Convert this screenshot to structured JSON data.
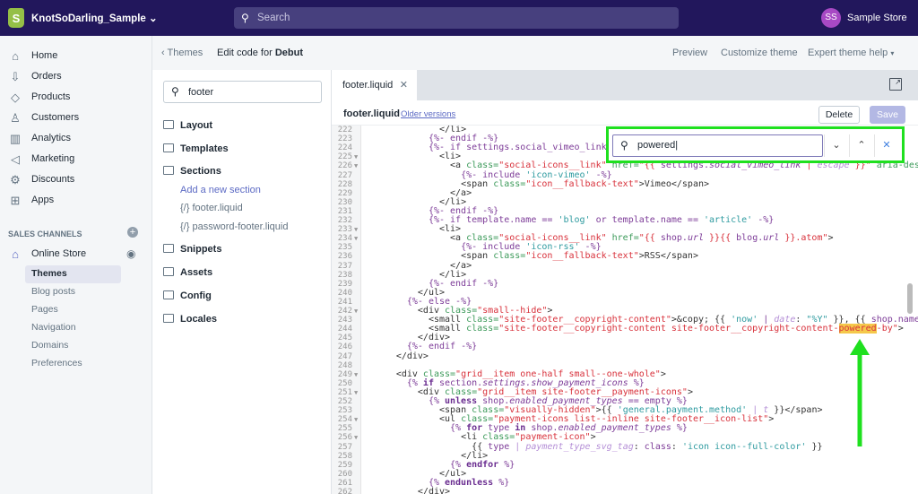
{
  "topbar": {
    "store_name": "KnotSoDarling_Sample",
    "search_placeholder": "Search",
    "avatar_initials": "SS",
    "account_name": "Sample Store",
    "bg": "#22175c"
  },
  "nav": {
    "items": [
      {
        "label": "Home",
        "icon": "home-icon",
        "glyph": "⌂"
      },
      {
        "label": "Orders",
        "icon": "orders-icon",
        "glyph": "⇩"
      },
      {
        "label": "Products",
        "icon": "tag-icon",
        "glyph": "◇"
      },
      {
        "label": "Customers",
        "icon": "person-icon",
        "glyph": "♙"
      },
      {
        "label": "Analytics",
        "icon": "bar-chart-icon",
        "glyph": "▥"
      },
      {
        "label": "Marketing",
        "icon": "megaphone-icon",
        "glyph": "◁"
      },
      {
        "label": "Discounts",
        "icon": "discount-icon",
        "glyph": "⚙"
      },
      {
        "label": "Apps",
        "icon": "apps-icon",
        "glyph": "⊞"
      }
    ],
    "section_label": "SALES CHANNELS",
    "online_store": "Online Store",
    "sub_items": [
      "Themes",
      "Blog posts",
      "Pages",
      "Navigation",
      "Domains",
      "Preferences"
    ]
  },
  "header": {
    "back": "Themes",
    "title_prefix": "Edit code for ",
    "theme": "Debut",
    "preview": "Preview",
    "customize": "Customize theme",
    "expert": "Expert theme help"
  },
  "files": {
    "search_value": "footer",
    "folders": [
      "Layout",
      "Templates",
      "Sections",
      "Snippets",
      "Assets",
      "Config",
      "Locales"
    ],
    "add_section": "Add a new section",
    "section_files": [
      "footer.liquid",
      "password-footer.liquid"
    ]
  },
  "editor": {
    "tab": "footer.liquid",
    "file": "footer.liquid",
    "older": "Older versions",
    "delete": "Delete",
    "save": "Save",
    "find": {
      "value": "powered",
      "next": "⌄",
      "prev": "⌃",
      "close": "✕"
    },
    "lines": [
      {
        "n": 222,
        "ind": 14,
        "t": [
          [
            "",
            "</li>"
          ]
        ]
      },
      {
        "n": 223,
        "ind": 12,
        "t": [
          [
            "k",
            "{%- endif -%}"
          ]
        ]
      },
      {
        "n": 224,
        "ind": 12,
        "t": [
          [
            "k",
            "{%- if settings.social_vimeo_link -%}"
          ]
        ]
      },
      {
        "n": 225,
        "ind": 14,
        "fold": true,
        "t": [
          [
            "",
            "<li>"
          ]
        ]
      },
      {
        "n": 226,
        "ind": 16,
        "fold": true,
        "t": [
          [
            "",
            "<a "
          ],
          [
            "a",
            "class="
          ],
          [
            "s",
            "\"social-icons__link\""
          ],
          [
            "a",
            " href="
          ],
          [
            "s",
            "\"{{ "
          ],
          [
            "k",
            "settings."
          ],
          [
            "i",
            "social_vimeo_link"
          ],
          [
            "s",
            " | "
          ],
          [
            "f",
            "escape"
          ],
          [
            "s",
            " }}\""
          ],
          [
            "a",
            " aria-describedby"
          ]
        ]
      },
      {
        "n": 227,
        "ind": 18,
        "t": [
          [
            "k",
            "{%- include "
          ],
          [
            "q",
            "'icon-vimeo'"
          ],
          [
            "k",
            " -%}"
          ]
        ]
      },
      {
        "n": 228,
        "ind": 18,
        "t": [
          [
            "",
            "<span "
          ],
          [
            "a",
            "class="
          ],
          [
            "s",
            "\"icon__fallback-text\""
          ],
          [
            "",
            ">Vimeo</span>"
          ]
        ]
      },
      {
        "n": 229,
        "ind": 16,
        "t": [
          [
            "",
            "</a>"
          ]
        ]
      },
      {
        "n": 230,
        "ind": 14,
        "t": [
          [
            "",
            "</li>"
          ]
        ]
      },
      {
        "n": 231,
        "ind": 12,
        "t": [
          [
            "k",
            "{%- endif -%}"
          ]
        ]
      },
      {
        "n": 232,
        "ind": 12,
        "t": [
          [
            "k",
            "{%- if template.name == "
          ],
          [
            "q",
            "'blog'"
          ],
          [
            "k",
            " or template.name == "
          ],
          [
            "q",
            "'article'"
          ],
          [
            "k",
            " -%}"
          ]
        ]
      },
      {
        "n": 233,
        "ind": 14,
        "fold": true,
        "t": [
          [
            "",
            "<li>"
          ]
        ]
      },
      {
        "n": 234,
        "ind": 16,
        "fold": true,
        "t": [
          [
            "",
            "<a "
          ],
          [
            "a",
            "class="
          ],
          [
            "s",
            "\"social-icons__link\""
          ],
          [
            "a",
            " href="
          ],
          [
            "s",
            "\"{{ "
          ],
          [
            "k",
            "shop."
          ],
          [
            "i",
            "url"
          ],
          [
            "s",
            " }}{{ "
          ],
          [
            "k",
            "blog."
          ],
          [
            "i",
            "url"
          ],
          [
            "s",
            " }}.atom\""
          ],
          [
            "",
            ">"
          ]
        ]
      },
      {
        "n": 235,
        "ind": 18,
        "t": [
          [
            "k",
            "{%- include "
          ],
          [
            "q",
            "'icon-rss'"
          ],
          [
            "k",
            " -%}"
          ]
        ]
      },
      {
        "n": 236,
        "ind": 18,
        "t": [
          [
            "",
            "<span "
          ],
          [
            "a",
            "class="
          ],
          [
            "s",
            "\"icon__fallback-text\""
          ],
          [
            "",
            ">RSS</span>"
          ]
        ]
      },
      {
        "n": 237,
        "ind": 16,
        "t": [
          [
            "",
            "</a>"
          ]
        ]
      },
      {
        "n": 238,
        "ind": 14,
        "t": [
          [
            "",
            "</li>"
          ]
        ]
      },
      {
        "n": 239,
        "ind": 12,
        "t": [
          [
            "k",
            "{%- endif -%}"
          ]
        ]
      },
      {
        "n": 240,
        "ind": 10,
        "t": [
          [
            "",
            "</ul>"
          ]
        ]
      },
      {
        "n": 241,
        "ind": 8,
        "t": [
          [
            "k",
            "{%- else -%}"
          ]
        ]
      },
      {
        "n": 242,
        "ind": 10,
        "fold": true,
        "t": [
          [
            "",
            "<div "
          ],
          [
            "a",
            "class="
          ],
          [
            "s",
            "\"small--hide\""
          ],
          [
            "",
            ">"
          ]
        ]
      },
      {
        "n": 243,
        "ind": 12,
        "t": [
          [
            "",
            "<small "
          ],
          [
            "a",
            "class="
          ],
          [
            "s",
            "\"site-footer__copyright-content\""
          ],
          [
            "",
            ">&copy; {{ "
          ],
          [
            "q",
            "'now'"
          ],
          [
            "k",
            " | "
          ],
          [
            "f",
            "date"
          ],
          [
            "",
            ": "
          ],
          [
            "q",
            "\"%Y\""
          ],
          [
            "",
            ""
          ],
          [
            "",
            " }}, {{ "
          ],
          [
            "k",
            "shop.name"
          ],
          [
            "",
            " }}"
          ]
        ]
      },
      {
        "n": 244,
        "ind": 12,
        "t": [
          [
            "",
            "<small "
          ],
          [
            "a",
            "class="
          ],
          [
            "s",
            "\"site-footer__copyright-content site-footer__copyright-content-"
          ],
          [
            "h",
            "powered"
          ],
          [
            "s",
            "-by\""
          ],
          [
            "",
            ">"
          ]
        ]
      },
      {
        "n": 245,
        "ind": 10,
        "t": [
          [
            "",
            "</div>"
          ]
        ]
      },
      {
        "n": 246,
        "ind": 8,
        "t": [
          [
            "k",
            "{%- endif -%}"
          ]
        ]
      },
      {
        "n": 247,
        "ind": 6,
        "t": [
          [
            "",
            "</div>"
          ]
        ]
      },
      {
        "n": 248,
        "ind": 0,
        "t": []
      },
      {
        "n": 249,
        "ind": 6,
        "fold": true,
        "t": [
          [
            "",
            "<div "
          ],
          [
            "a",
            "class="
          ],
          [
            "s",
            "\"grid__item one-half small--one-whole\""
          ],
          [
            "",
            ">"
          ]
        ]
      },
      {
        "n": 250,
        "ind": 8,
        "t": [
          [
            "k",
            "{% "
          ],
          [
            "b",
            "if"
          ],
          [
            "k",
            " section."
          ],
          [
            "i",
            "settings.show_payment_icons"
          ],
          [
            "k",
            " %}"
          ]
        ]
      },
      {
        "n": 251,
        "ind": 10,
        "fold": true,
        "t": [
          [
            "",
            "<div "
          ],
          [
            "a",
            "class="
          ],
          [
            "s",
            "\"grid__item site-footer__payment-icons\""
          ],
          [
            "",
            ">"
          ]
        ]
      },
      {
        "n": 252,
        "ind": 12,
        "t": [
          [
            "k",
            "{% "
          ],
          [
            "b",
            "unless"
          ],
          [
            "k",
            " shop."
          ],
          [
            "i",
            "enabled_payment_types"
          ],
          [
            "k",
            " == empty %}"
          ]
        ]
      },
      {
        "n": 253,
        "ind": 14,
        "t": [
          [
            "",
            "<span "
          ],
          [
            "a",
            "class="
          ],
          [
            "s",
            "\"visually-hidden\""
          ],
          [
            "",
            ">{{ "
          ],
          [
            "q",
            "'general.payment.method'"
          ],
          [
            "f",
            " | t"
          ],
          [
            "",
            " }}</span>"
          ]
        ]
      },
      {
        "n": 254,
        "ind": 14,
        "fold": true,
        "t": [
          [
            "",
            "<ul "
          ],
          [
            "a",
            "class="
          ],
          [
            "s",
            "\"payment-icons list--inline site-footer__icon-list\""
          ],
          [
            "",
            ">"
          ]
        ]
      },
      {
        "n": 255,
        "ind": 16,
        "t": [
          [
            "k",
            "{% "
          ],
          [
            "b",
            "for"
          ],
          [
            "k",
            " type "
          ],
          [
            "b",
            "in"
          ],
          [
            "k",
            " shop."
          ],
          [
            "i",
            "enabled_payment_types"
          ],
          [
            "k",
            " %}"
          ]
        ]
      },
      {
        "n": 256,
        "ind": 18,
        "fold": true,
        "t": [
          [
            "",
            "<li "
          ],
          [
            "a",
            "class="
          ],
          [
            "s",
            "\"payment-icon\""
          ],
          [
            "",
            ">"
          ]
        ]
      },
      {
        "n": 257,
        "ind": 20,
        "t": [
          [
            "",
            "{{ "
          ],
          [
            "k",
            "type"
          ],
          [
            "f",
            " | payment_type_svg_tag"
          ],
          [
            "",
            ": "
          ],
          [
            "k",
            "class"
          ],
          [
            "",
            ": "
          ],
          [
            "q",
            "'icon icon--full-color'"
          ],
          [
            "",
            " }}"
          ]
        ]
      },
      {
        "n": 258,
        "ind": 18,
        "t": [
          [
            "",
            "</li>"
          ]
        ]
      },
      {
        "n": 259,
        "ind": 16,
        "t": [
          [
            "k",
            "{% "
          ],
          [
            "b",
            "endfor"
          ],
          [
            "k",
            " %}"
          ]
        ]
      },
      {
        "n": 260,
        "ind": 14,
        "t": [
          [
            "",
            "</ul>"
          ]
        ]
      },
      {
        "n": 261,
        "ind": 12,
        "t": [
          [
            "k",
            "{% "
          ],
          [
            "b",
            "endunless"
          ],
          [
            "k",
            " %}"
          ]
        ]
      },
      {
        "n": 262,
        "ind": 10,
        "t": [
          [
            "",
            "</div>"
          ]
        ]
      }
    ]
  },
  "colors": {
    "annotation": "#1fe01f",
    "highlight": "#f5c84a",
    "accent": "#5c6ac4"
  }
}
